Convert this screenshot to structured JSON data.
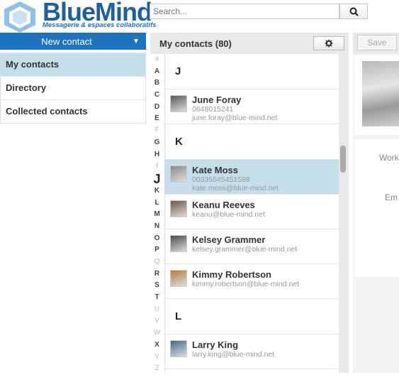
{
  "app": {
    "name": "BlueMind",
    "tagline": "Messagerie & espaces collaboratifs"
  },
  "search": {
    "placeholder": "Search..."
  },
  "sidebar": {
    "new_contact_label": "New contact",
    "items": [
      {
        "label": "My contacts",
        "active": true
      },
      {
        "label": "Directory",
        "active": false
      },
      {
        "label": "Collected contacts",
        "active": false
      }
    ]
  },
  "list": {
    "title": "My contacts (80)",
    "alphabet": [
      "#",
      "A",
      "B",
      "C",
      "D",
      "E",
      "F",
      "G",
      "H",
      "I",
      "J",
      "K",
      "L",
      "M",
      "N",
      "O",
      "P",
      "Q",
      "R",
      "S",
      "T",
      "U",
      "V",
      "W",
      "X",
      "Y",
      "Z"
    ],
    "current_letter": "J",
    "sections": [
      {
        "letter": "J",
        "contacts": [
          {
            "name": "June Foray",
            "line2": "0648015241",
            "line3": "june.foray@blue-mind.net",
            "selected": false
          }
        ]
      },
      {
        "letter": "K",
        "contacts": [
          {
            "name": "Kate Moss",
            "line2": "00335545451588",
            "line3": "kate.moss@blue-mind.net",
            "selected": true
          },
          {
            "name": "Keanu Reeves",
            "line2": "keanu@blue-mind.net",
            "line3": "",
            "selected": false
          },
          {
            "name": "Kelsey Grammer",
            "line2": "kelsey.grammer@blue-mind.net",
            "line3": "",
            "selected": false
          },
          {
            "name": "Kimmy Robertson",
            "line2": "kimmy.robertson@blue-mind.net",
            "line3": "",
            "selected": false
          }
        ]
      },
      {
        "letter": "L",
        "contacts": [
          {
            "name": "Larry King",
            "line2": "larry.king@blue-mind.net",
            "line3": "",
            "selected": false
          }
        ]
      }
    ]
  },
  "detail": {
    "save_label": "Save",
    "work_label": "Work",
    "email_label": "Em"
  },
  "colors": {
    "accent": "#1e73be",
    "selected_row": "#c4deea",
    "logo": "#1d5fa0"
  }
}
